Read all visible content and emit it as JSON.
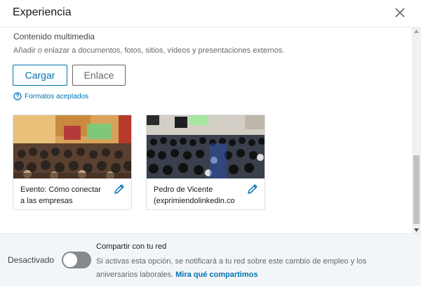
{
  "header": {
    "title": "Experiencia",
    "close_icon": "close-icon"
  },
  "media": {
    "title": "Contenido multimedia",
    "description": "Añadir o enlazar a documentos, fotos, sitios, vídeos y presentaciones externos.",
    "upload_label": "Cargar",
    "link_label": "Enlace",
    "formats_label": "Formatos aceptados",
    "items": [
      {
        "caption_line1": "Evento: Cómo conectar",
        "caption_line2": "a las empresas",
        "thumb_icon": "event-photo-thumbnail"
      },
      {
        "caption_line1": "Pedro de Vicente",
        "caption_line2": "(exprimiendolinkedin.co",
        "thumb_icon": "auditorium-photo-thumbnail"
      }
    ]
  },
  "footer": {
    "toggle_label": "Desactivado",
    "toggle_state": "off",
    "share_title": "Compartir con tu red",
    "share_desc": "Si activas esta opción, se notificará a tu red sobre este cambio de empleo y los aniversarios laborales.",
    "share_link": "Mira qué compartimos"
  },
  "colors": {
    "accent": "#0073b1",
    "toggle_off": "#86888a",
    "footer_bg": "#f3f6f8"
  }
}
